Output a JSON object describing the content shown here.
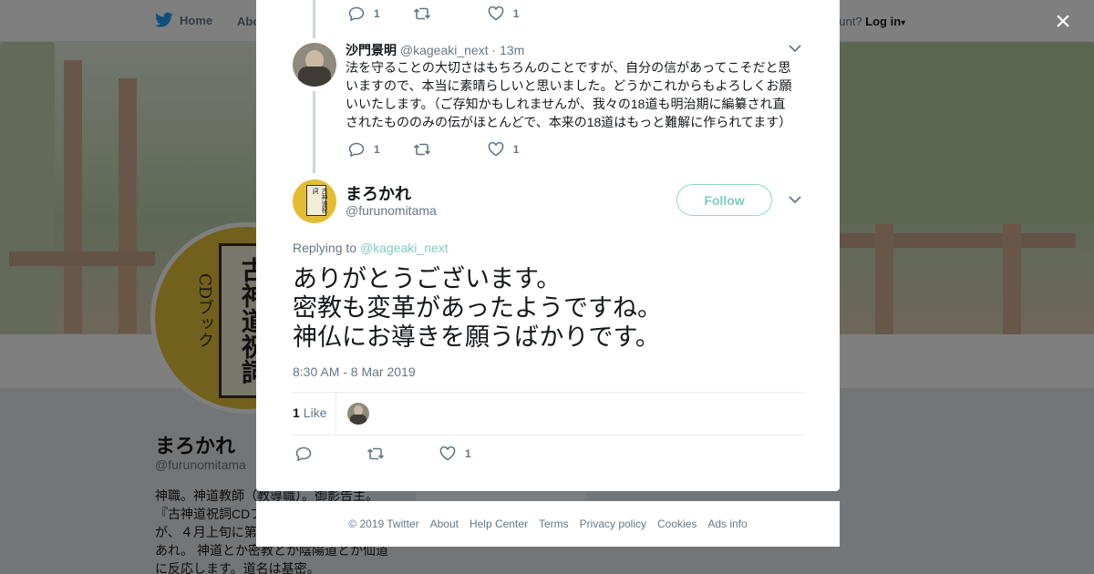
{
  "nav": {
    "home_label": "Home",
    "about_label": "Abo",
    "account_prompt": "ccount?",
    "login_label": "Log in"
  },
  "profile": {
    "name": "まろかれ",
    "handle": "@furunomitama",
    "avatar_book_title": "古神道祝詞",
    "avatar_book_sub": "CDブック",
    "bio_lines": [
      "神職。神道教師（教導職）。御影告主。",
      "『古神道祝詞CDブ",
      "が、４月上旬に第",
      "あれ。 神道とか密教とか陰陽道とか仙道",
      "に反応します。道名は基密。"
    ]
  },
  "modal": {
    "close_label": "×",
    "prev_tweet_actions": {
      "reply_count": "1",
      "like_count": "1"
    },
    "reply_tweet": {
      "name": "沙門景明",
      "handle": "@kageaki_next",
      "separator": "·",
      "time": "13m",
      "text_lines": [
        "法を守ることの大切さはもちろんのことですが、自分の信があってこそだと思",
        "いますので、本当に素晴らしいと思いました。どうかこれからもよろしくお願",
        "いいたします。（ご存知かもしれませんが、我々の18道も明治期に編纂され直",
        "されたもののみの伝がほとんどで、本来の18道はもっと難解に作られてます）"
      ],
      "reply_count": "1",
      "like_count": "1"
    },
    "main_tweet": {
      "name": "まろかれ",
      "handle": "@furunomitama",
      "avatar_book_text": "古神道祝詞",
      "follow_label": "Follow",
      "replying_prefix": "Replying to",
      "replying_handle": "@kageaki_next",
      "text_lines": [
        "ありがとうございます。",
        "密教も変革があったようですね。",
        "神仏にお導きを願うばかりです。"
      ],
      "timestamp": "8:30 AM - 8 Mar 2019",
      "likes_count": "1",
      "likes_label": "Like",
      "like_action_count": "1"
    }
  },
  "footer": {
    "links": [
      "© 2019 Twitter",
      "About",
      "Help Center",
      "Terms",
      "Privacy policy",
      "Cookies",
      "Ads info"
    ]
  },
  "colors": {
    "twitter_blue": "#1da1f2",
    "accent_green": "#7fcdbb",
    "text_secondary": "#657786"
  },
  "icons": {
    "reply": "reply-icon",
    "retweet": "retweet-icon",
    "like": "heart-icon",
    "chevron": "chevron-down-icon",
    "close": "close-icon",
    "logo": "twitter-bird-icon"
  }
}
